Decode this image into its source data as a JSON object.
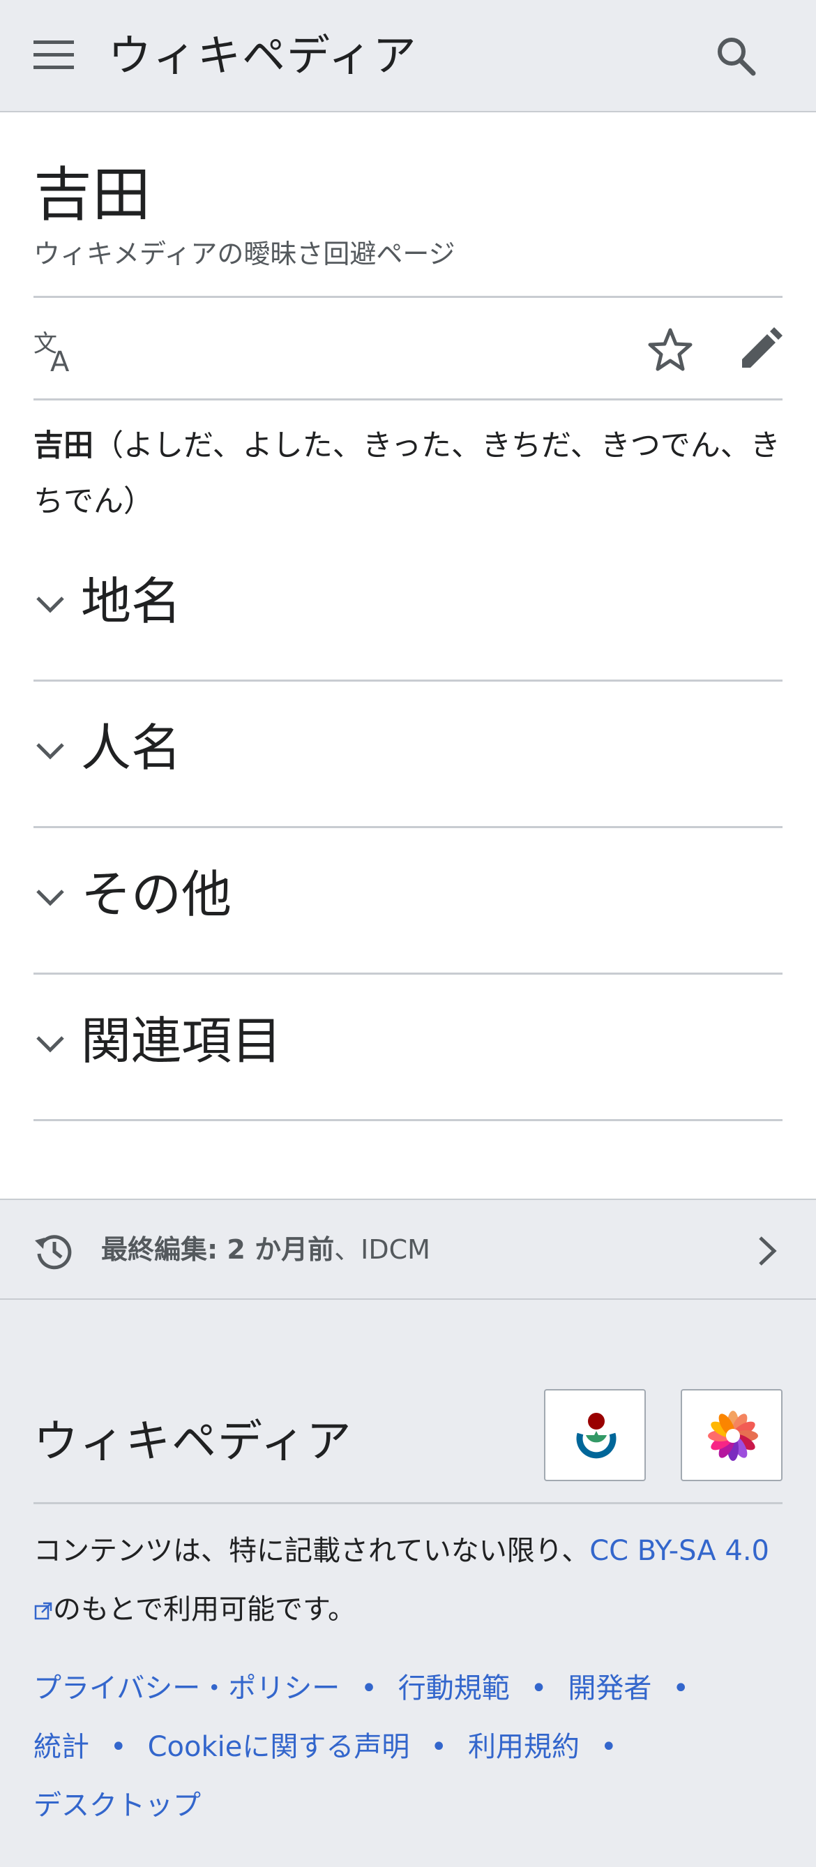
{
  "header": {
    "wordmark": "ウィキペディア",
    "menu_icon": "hamburger-menu-icon",
    "search_icon": "search-icon"
  },
  "page": {
    "title": "吉田",
    "tagline": "ウィキメディアの曖昧さ回避ページ"
  },
  "actions": {
    "language_icon": "language-icon",
    "watch_icon": "star-icon",
    "edit_icon": "pencil-icon"
  },
  "intro": {
    "bold": "吉田",
    "rest": "（よしだ、よした、きった、きちだ、きつでん、きちでん）"
  },
  "sections": [
    {
      "label": "地名"
    },
    {
      "label": "人名"
    },
    {
      "label": "その他"
    },
    {
      "label": "関連項目"
    }
  ],
  "last_edit": {
    "prefix_bold": "最終編集: 2 か月前",
    "separator": "、",
    "editor": "IDCM"
  },
  "footer": {
    "wordmark": "ウィキペディア",
    "license_text_before": "コンテンツは、特に記載されていない限り、",
    "license_link": "CC BY-SA 4.0",
    "license_text_after": "のもとで利用可能です。",
    "links": [
      "プライバシー・ポリシー",
      "行動規範",
      "開発者",
      "統計",
      "Cookieに関する声明",
      "利用規約",
      "デスクトップ"
    ]
  },
  "colors": {
    "link": "#3366cc",
    "chrome_bg": "#eaecf0",
    "divider": "#c8ccd1",
    "text": "#202122",
    "muted": "#54595d"
  }
}
